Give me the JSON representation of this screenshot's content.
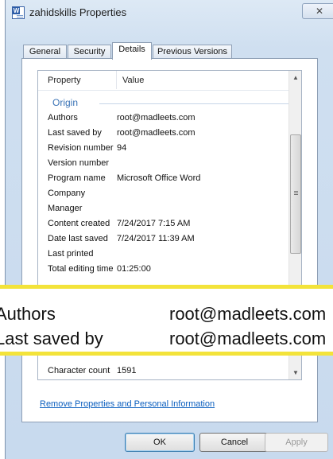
{
  "window": {
    "title": "zahidskills Properties",
    "close_glyph": "✕",
    "app_icon": "word-document-icon"
  },
  "tabs": [
    {
      "label": "General",
      "active": false
    },
    {
      "label": "Security",
      "active": false
    },
    {
      "label": "Details",
      "active": true
    },
    {
      "label": "Previous Versions",
      "active": false
    }
  ],
  "grid": {
    "header_property": "Property",
    "header_value": "Value",
    "group": "Origin",
    "rows": [
      {
        "key": "Authors",
        "value": "root@madleets.com"
      },
      {
        "key": "Last saved by",
        "value": "root@madleets.com"
      },
      {
        "key": "Revision number",
        "value": "94"
      },
      {
        "key": "Version number",
        "value": ""
      },
      {
        "key": "Program name",
        "value": "Microsoft Office Word"
      },
      {
        "key": "Company",
        "value": ""
      },
      {
        "key": "Manager",
        "value": ""
      },
      {
        "key": "Content created",
        "value": "7/24/2017 7:15 AM"
      },
      {
        "key": "Date last saved",
        "value": "7/24/2017 11:39 AM"
      },
      {
        "key": "Last printed",
        "value": ""
      },
      {
        "key": "Total editing time",
        "value": "01:25:00"
      }
    ],
    "bottom_row": {
      "key": "Character count",
      "value": "1591"
    }
  },
  "zoom_callout": [
    {
      "key": "Authors",
      "value": "root@madleets.com"
    },
    {
      "key": "Last saved by",
      "value": "root@madleets.com"
    }
  ],
  "remove_link": "Remove Properties and Personal Information",
  "buttons": {
    "ok": "OK",
    "cancel": "Cancel",
    "apply": "Apply"
  },
  "colors": {
    "highlight_border": "#f3e33a",
    "group_heading": "#3a73b6",
    "link": "#0b5fbf"
  }
}
